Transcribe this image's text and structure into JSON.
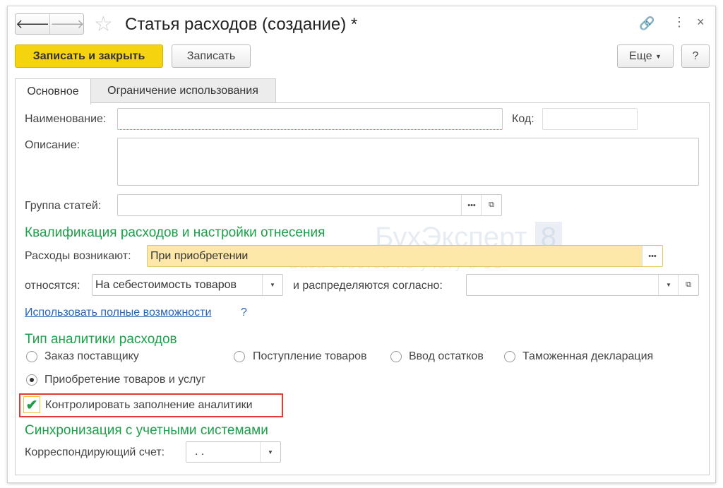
{
  "window": {
    "title": "Статья расходов (создание) *"
  },
  "toolbar": {
    "save_close": "Записать и закрыть",
    "save": "Записать",
    "more": "Еще",
    "help": "?"
  },
  "tabs": [
    {
      "label": "Основное",
      "active": true
    },
    {
      "label": "Ограничение использования",
      "active": false
    }
  ],
  "form": {
    "name_label": "Наименование:",
    "name_value": "",
    "code_label": "Код:",
    "code_value": "",
    "desc_label": "Описание:",
    "desc_value": "",
    "group_label": "Группа статей:",
    "group_value": "",
    "sec1": "Квалификация расходов и настройки отнесения",
    "arise_label": "Расходы возникают:",
    "arise_value": "При приобретении",
    "relate_label": "относятся:",
    "relate_value": "На себестоимость товаров",
    "distr_label": "и распределяются согласно:",
    "distr_value": "",
    "full_link": "Использовать полные возможности",
    "full_help": "?",
    "sec2": "Тип аналитики расходов",
    "radios": [
      {
        "label": "Заказ поставщику",
        "checked": false
      },
      {
        "label": "Поступление товаров",
        "checked": false
      },
      {
        "label": "Ввод остатков",
        "checked": false
      },
      {
        "label": "Таможенная декларация",
        "checked": false
      },
      {
        "label": "Приобретение товаров и услуг",
        "checked": true
      }
    ],
    "control_label": "Контролировать заполнение аналитики",
    "control_checked": true,
    "sec3": "Синхронизация с учетными системами",
    "account_label": "Корреспондирующий счет:",
    "account_value": ". ."
  },
  "watermark": {
    "brand": "БухЭксперт",
    "num": "8",
    "tagline": "База ответов по учёту в 1С"
  },
  "colors": {
    "accent": "#1ea04b",
    "primary_button": "#f5d40f",
    "highlight": "#e53935"
  }
}
